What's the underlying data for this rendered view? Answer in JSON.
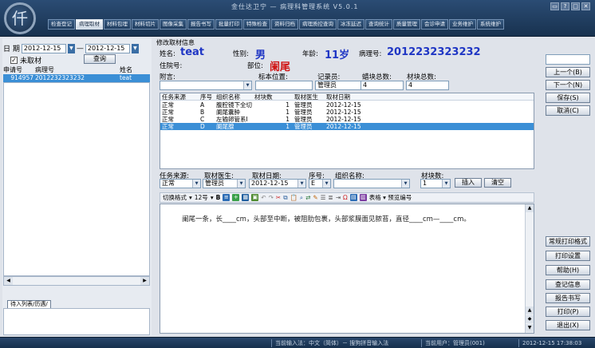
{
  "app": {
    "logo_text": "仟",
    "window_title": "金仕达卫宁 — 病理科管理系统 V5.0.1",
    "window_controls": [
      "▭",
      "?",
      "□",
      "✕"
    ]
  },
  "tabs": [
    "检查登记",
    "病理取材",
    "材料包埋",
    "材料切片",
    "图像采集",
    "报告书写",
    "批量打印",
    "特殊检查",
    "资料归档",
    "病理质控查询",
    "冰冻延迟",
    "查询统计",
    "质量管理",
    "会诊申请",
    "业务维护",
    "系统维护"
  ],
  "active_tab_index": 1,
  "left": {
    "date_label": "日 期",
    "date_from": "2012-12-15",
    "date_separator": "—",
    "date_to": "2012-12-15",
    "not_sampled_label": "未取材",
    "not_sampled_checked": true,
    "query_button": "查询",
    "columns": [
      "申请号",
      "病理号",
      "姓名"
    ],
    "rows": [
      {
        "apply_no": "914957",
        "pathology_no": "2012232323232",
        "name": "teat"
      }
    ],
    "list_tab": "待入列表/历遇/"
  },
  "form": {
    "group_title": "修改取材信息",
    "name_label": "姓名:",
    "name_value": "teat",
    "gender_label": "性别:",
    "gender_value": "男",
    "age_label": "年龄:",
    "age_value": "11岁",
    "pathology_no_label": "病理号:",
    "pathology_no_value": "2012232323232",
    "bed_label": "住院号:",
    "dept_label": "部位:",
    "dept_value": "阑尾",
    "note_label": "附言:",
    "location_label": "标本位置:",
    "recorder_label": "记录员:",
    "recorder_value": "管理员",
    "wax_total_label": "蜡块总数:",
    "wax_total_value": "4",
    "material_total_label": "材块总数:",
    "material_total_value": "4"
  },
  "grid": {
    "columns": [
      "任务来源",
      "序号",
      "组织名称",
      "材块数",
      "取材医生",
      "取材日期"
    ],
    "rows": [
      {
        "source": "正常",
        "seq": "A",
        "tissue": "腹腔镜下全切",
        "count": "1",
        "doctor": "管理员",
        "date": "2012-12-15"
      },
      {
        "source": "正常",
        "seq": "B",
        "tissue": "阑尾囊肿",
        "count": "1",
        "doctor": "管理员",
        "date": "2012-12-15"
      },
      {
        "source": "正常",
        "seq": "C",
        "tissue": "左输卵管系Ⅰ",
        "count": "1",
        "doctor": "管理员",
        "date": "2012-12-15"
      },
      {
        "source": "正常",
        "seq": "D",
        "tissue": "阑尾腺",
        "count": "1",
        "doctor": "管理员",
        "date": "2012-12-15"
      }
    ],
    "selected_row": 3
  },
  "add_form": {
    "source_label": "任务来源:",
    "source_value": "正常",
    "doctor_label": "取材医生:",
    "doctor_value": "管理员",
    "date_label": "取材日期:",
    "date_value": "2012-12-15",
    "seq_label": "序号:",
    "seq_value": "E",
    "tissue_label": "组织名称:",
    "tissue_value": "",
    "count_label": "材块数:",
    "count_value": "1",
    "add_button": "插入",
    "clear_button": "清空"
  },
  "format_bar": {
    "mode": "切换格式",
    "size": "12号",
    "tail": "表格 ▾  预览编号"
  },
  "editor": {
    "text": "阑尾一条，长____cm，头部至中断，被阻肋包裹，头部浆膜面见脓苔，直径____cm—____cm。"
  },
  "right_buttons": [
    "上一个(B)",
    "下一个(N)",
    "保存(S)",
    "取消(C)",
    "常规打印格式",
    "打印设置",
    "帮助(H)",
    "查记信息",
    "报告书写",
    "打印(P)",
    "退出(X)"
  ],
  "status": {
    "input_method": "当前输入法：中文（简体）－ 搜狗拼音输入法",
    "user": "当前用户：管理员(001)",
    "datetime": "2012-12-15 17:38:03"
  }
}
